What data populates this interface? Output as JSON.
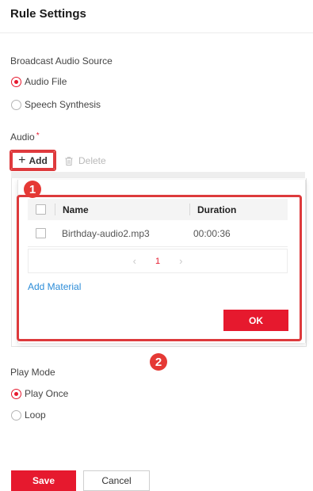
{
  "header": {
    "title": "Rule Settings"
  },
  "broadcast_source": {
    "label": "Broadcast Audio Source",
    "options": [
      {
        "label": "Audio File",
        "checked": true
      },
      {
        "label": "Speech Synthesis",
        "checked": false
      }
    ]
  },
  "audio": {
    "label": "Audio",
    "required_mark": "*",
    "add_label": "Add",
    "delete_label": "Delete"
  },
  "popup": {
    "columns": {
      "name": "Name",
      "duration": "Duration"
    },
    "rows": [
      {
        "name": "Birthday-audio2.mp3",
        "duration": "00:00:36"
      }
    ],
    "pager": {
      "prev": "‹",
      "page": "1",
      "next": "›"
    },
    "add_material_label": "Add Material",
    "ok_label": "OK"
  },
  "annotations": {
    "badge_1": "1",
    "badge_2": "2",
    "color": "#e53935"
  },
  "play_mode": {
    "label": "Play Mode",
    "options": [
      {
        "label": "Play Once",
        "checked": true
      },
      {
        "label": "Loop",
        "checked": false
      }
    ]
  },
  "footer": {
    "save_label": "Save",
    "cancel_label": "Cancel"
  },
  "colors": {
    "accent": "#e6192e",
    "link": "#2b8cd8"
  }
}
